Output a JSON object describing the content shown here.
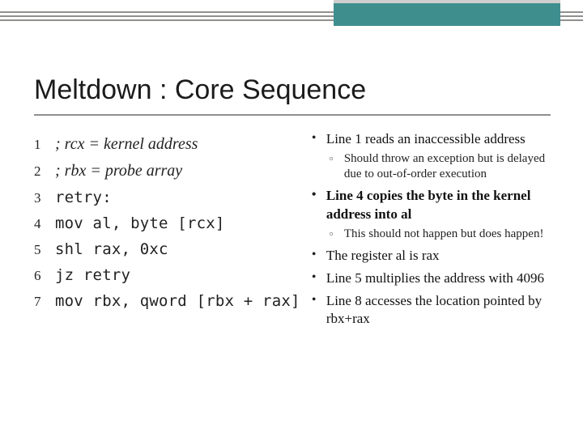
{
  "title": "Meltdown : Core Sequence",
  "code": {
    "l1_num": "1",
    "l1_text": "; rcx = kernel address",
    "l2_num": "2",
    "l2_text": "; rbx = probe array",
    "l3_num": "3",
    "l3_text": "retry:",
    "l4_num": "4",
    "l4_text": "mov al, byte [rcx]",
    "l5_num": "5",
    "l5_text": "shl rax, 0xc",
    "l6_num": "6",
    "l6_text": "jz retry",
    "l7_num": "7",
    "l7_text": "mov rbx, qword [rbx + rax]"
  },
  "bullets": {
    "b1": "Line 1 reads an inaccessible address",
    "b1_sub": "Should throw an exception but is delayed due to out-of-order execution",
    "b2": "Line 4 copies the byte in the kernel address into al",
    "b2_sub": "This should not happen but does happen!",
    "b3": "The register al is rax",
    "b4": "Line 5 multiplies the address with 4096",
    "b5": "Line 8 accesses the location pointed by rbx+rax"
  }
}
